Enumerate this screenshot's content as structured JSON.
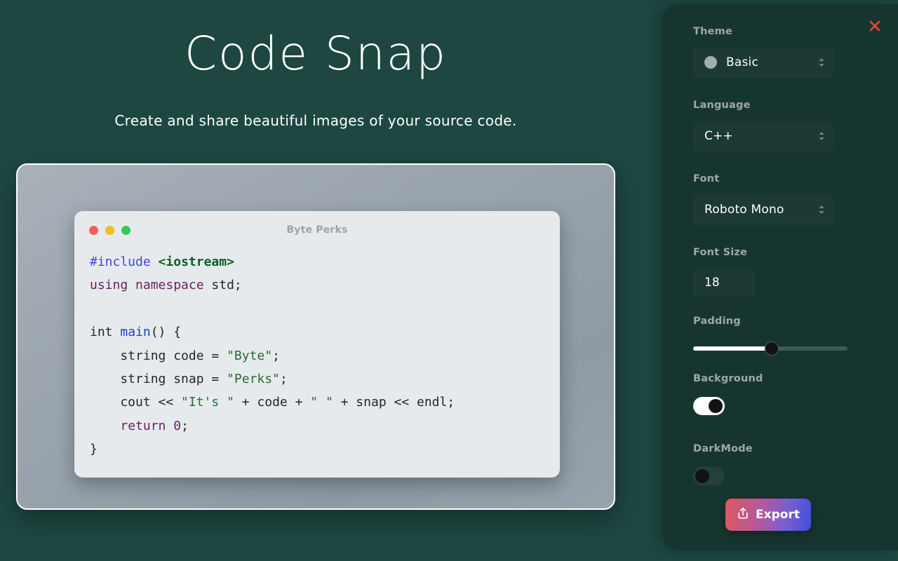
{
  "app": {
    "title": "Code Snap",
    "subtitle": "Create and share beautiful images of your source code."
  },
  "preview": {
    "window_title": "Byte Perks",
    "traffic_lights": [
      "close-dot",
      "minimize-dot",
      "maximize-dot"
    ],
    "code_lines": [
      [
        {
          "t": "#include ",
          "c": "tk-pre"
        },
        {
          "t": "<iostream>",
          "c": "tk-inc"
        }
      ],
      [
        {
          "t": "using namespace ",
          "c": "tk-kw"
        },
        {
          "t": "std;",
          "c": "tk-pl"
        }
      ],
      [],
      [
        {
          "t": "int ",
          "c": "tk-typ"
        },
        {
          "t": "main",
          "c": "tk-fn"
        },
        {
          "t": "() {",
          "c": "tk-pl"
        }
      ],
      [
        {
          "t": "    string code = ",
          "c": "tk-pl"
        },
        {
          "t": "\"Byte\"",
          "c": "tk-str"
        },
        {
          "t": ";",
          "c": "tk-pl"
        }
      ],
      [
        {
          "t": "    string snap = ",
          "c": "tk-pl"
        },
        {
          "t": "\"Perks\"",
          "c": "tk-str"
        },
        {
          "t": ";",
          "c": "tk-pl"
        }
      ],
      [
        {
          "t": "    cout << ",
          "c": "tk-pl"
        },
        {
          "t": "\"It's \"",
          "c": "tk-str"
        },
        {
          "t": " + code + ",
          "c": "tk-pl"
        },
        {
          "t": "\" \"",
          "c": "tk-str"
        },
        {
          "t": " + snap << endl;",
          "c": "tk-pl"
        }
      ],
      [
        {
          "t": "    ",
          "c": "tk-pl"
        },
        {
          "t": "return ",
          "c": "tk-kw"
        },
        {
          "t": "0",
          "c": "tk-num"
        },
        {
          "t": ";",
          "c": "tk-pl"
        }
      ],
      [
        {
          "t": "}",
          "c": "tk-pl"
        }
      ]
    ]
  },
  "sidebar": {
    "close_label": "close-icon",
    "theme": {
      "label": "Theme",
      "value": "Basic",
      "swatch_color": "#a3acb3"
    },
    "language": {
      "label": "Language",
      "value": "C++"
    },
    "font": {
      "label": "Font",
      "value": "Roboto Mono"
    },
    "font_size": {
      "label": "Font Size",
      "value": "18"
    },
    "padding": {
      "label": "Padding",
      "value": 50,
      "min": 0,
      "max": 100
    },
    "background": {
      "label": "Background",
      "state": "on"
    },
    "dark_mode": {
      "label": "DarkMode",
      "state": "off"
    },
    "export": {
      "label": "Export",
      "icon": "share-upload-icon",
      "gradient_from": "#e0585f",
      "gradient_to": "#3f4fdb"
    }
  },
  "colors": {
    "page_background": "#1d4740",
    "sidebar_background": "#17352f",
    "frame_gradient_from": "#a8b0b8",
    "frame_gradient_to": "#98a2ab",
    "code_background": "#e6eaed",
    "close_icon": "#ef4430"
  }
}
